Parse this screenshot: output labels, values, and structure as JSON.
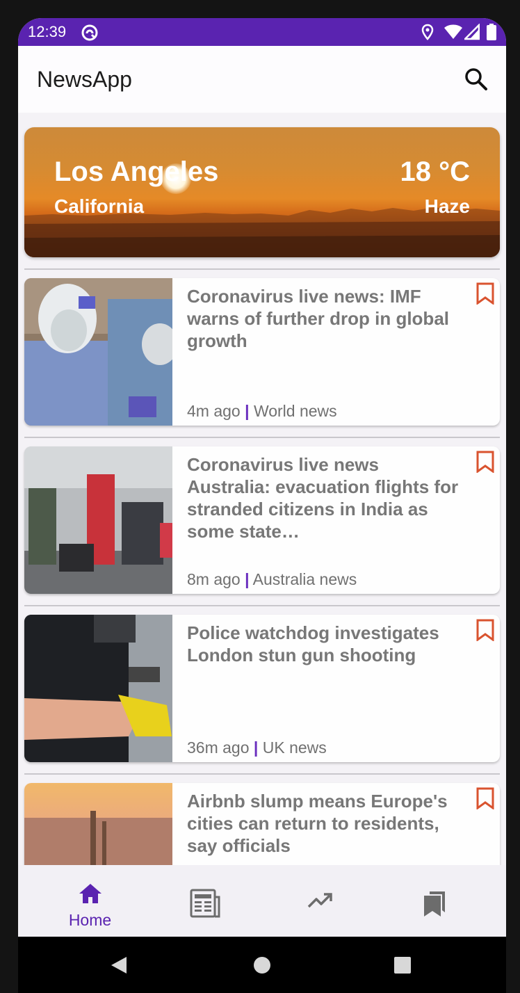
{
  "status_bar": {
    "time": "12:39"
  },
  "app_bar": {
    "title": "NewsApp"
  },
  "weather": {
    "city": "Los Angeles",
    "state": "California",
    "temperature": "18 °C",
    "condition": "Haze"
  },
  "articles": [
    {
      "headline": "Coronavirus live news: IMF warns of further drop in global growth",
      "time": "4m ago",
      "section": "World news"
    },
    {
      "headline": "Coronavirus live news Australia: evacuation flights for stranded citizens in India as some state…",
      "time": "8m ago",
      "section": "Australia news"
    },
    {
      "headline": "Police watchdog investigates London stun gun shooting",
      "time": "36m ago",
      "section": "UK news"
    },
    {
      "headline": "Airbnb slump means Europe's cities can return to residents, say officials",
      "time": "",
      "section": ""
    }
  ],
  "meta_separator": "|",
  "bottom_nav": {
    "home_label": "Home",
    "active": "home"
  },
  "colors": {
    "status_bar": "#5a23b0",
    "accent": "#5a23b0",
    "bookmark": "#d9532f"
  }
}
